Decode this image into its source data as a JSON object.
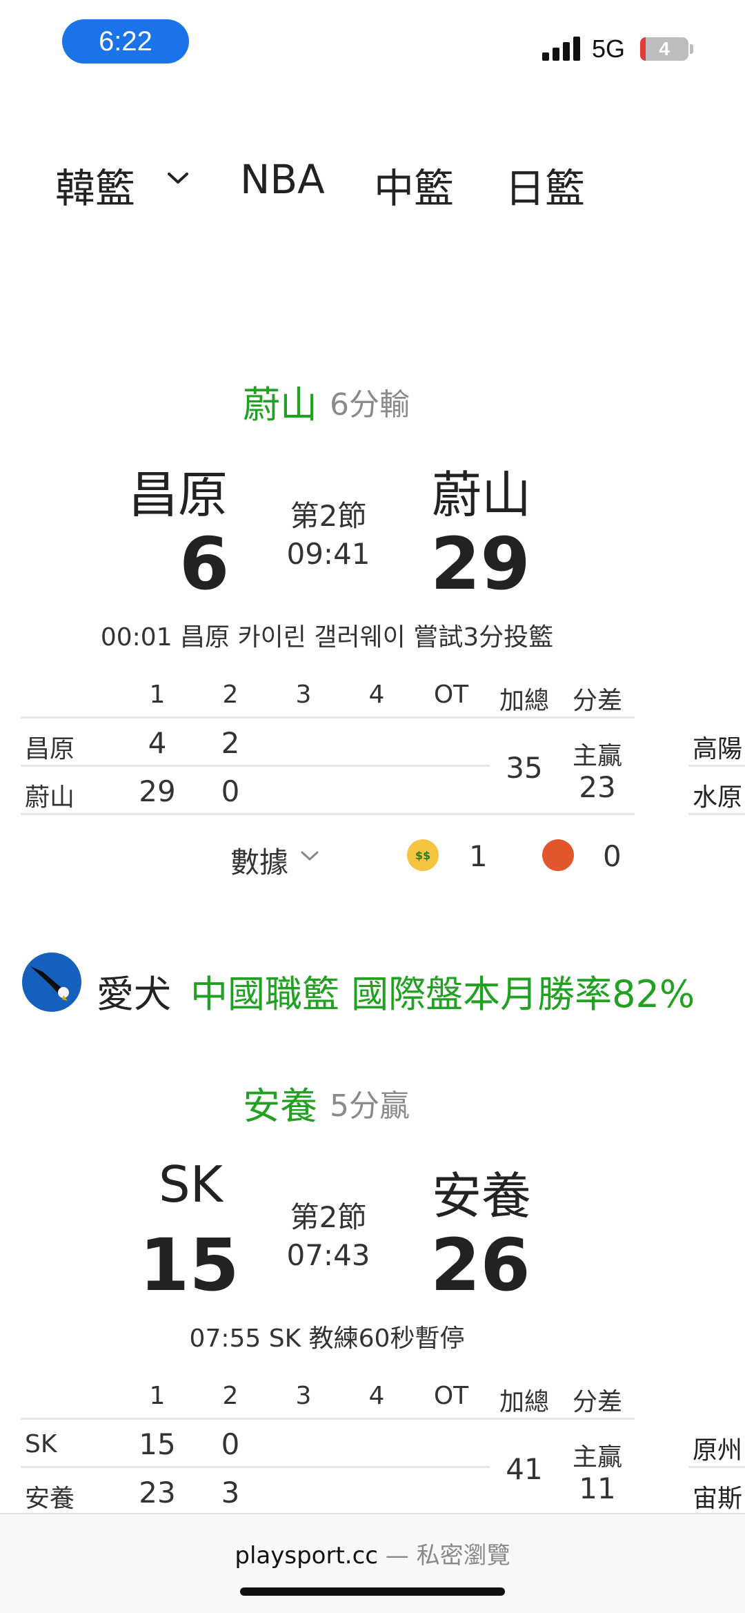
{
  "status_bar": {
    "time": "6:22",
    "network": "5G",
    "battery": "4"
  },
  "league_tabs": [
    {
      "label": "韓籃",
      "has_dropdown": true
    },
    {
      "label": "NBA"
    },
    {
      "label": "中籃"
    },
    {
      "label": "日籃"
    }
  ],
  "table_headers": [
    "1",
    "2",
    "3",
    "4",
    "OT",
    "加總",
    "分差"
  ],
  "games": [
    {
      "leader_team": "蔚山",
      "leader_note": "6分輸",
      "away_team": "昌原",
      "home_team": "蔚山",
      "away_score": "6",
      "home_score": "29",
      "period": "第2節",
      "clock": "09:41",
      "last_play": "00:01 昌原 카이린 갤러웨이 嘗試3分投籃",
      "rows": [
        {
          "team": "昌原",
          "q1": "4",
          "q2": "2"
        },
        {
          "team": "蔚山",
          "q1": "29",
          "q2": "0"
        }
      ],
      "total": "35",
      "diff_label": "主贏",
      "diff_value": "23",
      "adjacent_teams": [
        "高陽",
        "水原"
      ],
      "stats_label": "數據",
      "emoji_money_count": "1",
      "emoji_angry_count": "0"
    },
    {
      "leader_team": "安養",
      "leader_note": "5分贏",
      "away_team": "SK",
      "home_team": "安養",
      "away_score": "15",
      "home_score": "26",
      "period": "第2節",
      "clock": "07:43",
      "last_play": "07:55 SK 教練60秒暫停",
      "rows": [
        {
          "team": "SK",
          "q1": "15",
          "q2": "0"
        },
        {
          "team": "安養",
          "q1": "23",
          "q2": "3"
        }
      ],
      "total": "41",
      "diff_label": "主贏",
      "diff_value": "11",
      "adjacent_teams": [
        "原州",
        "宙斯"
      ]
    }
  ],
  "banner": {
    "author": "愛犬",
    "promo": "中國職籃 國際盤本月勝率82%"
  },
  "bottom_bar": {
    "domain": "playsport.cc",
    "separator": "—",
    "mode": "私密瀏覽"
  },
  "colors": {
    "accent_green": "#22a022",
    "status_pill": "#1a73e8"
  }
}
